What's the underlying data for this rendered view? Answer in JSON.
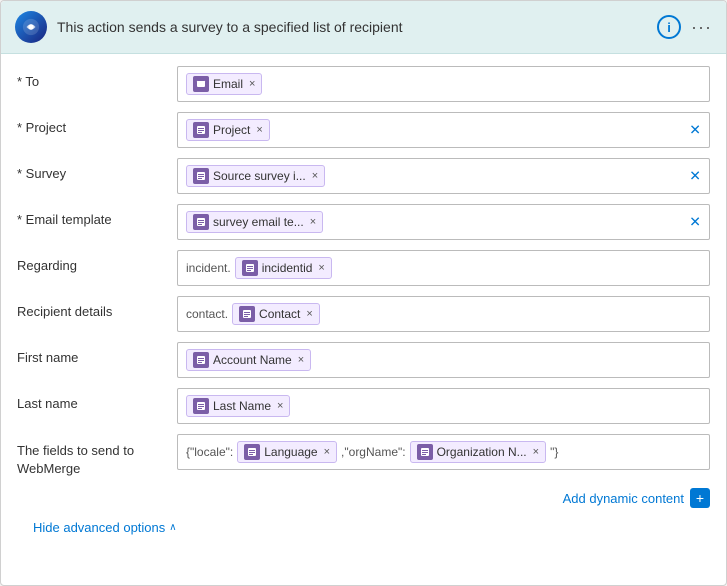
{
  "header": {
    "title": "This action sends a survey to a specified list of recipient",
    "info_label": "i",
    "dots_label": "···"
  },
  "fields": {
    "to": {
      "label": "* To",
      "required": true,
      "chips": [
        {
          "text": "Email",
          "id": "to-email"
        }
      ]
    },
    "project": {
      "label": "* Project",
      "required": true,
      "chips": [
        {
          "text": "Project",
          "id": "project-chip"
        }
      ],
      "has_x": true
    },
    "survey": {
      "label": "* Survey",
      "required": true,
      "chips": [
        {
          "text": "Source survey i...",
          "id": "survey-chip"
        }
      ],
      "has_x": true
    },
    "email_template": {
      "label": "* Email template",
      "required": true,
      "chips": [
        {
          "text": "survey email te...",
          "id": "email-template-chip"
        }
      ],
      "has_x": true
    },
    "regarding": {
      "label": "Regarding",
      "prefix": "incident.",
      "chips": [
        {
          "text": "incidentid",
          "id": "regarding-chip"
        }
      ]
    },
    "recipient_details": {
      "label": "Recipient details",
      "prefix": "contact.",
      "chips": [
        {
          "text": "Contact",
          "id": "recipient-chip"
        }
      ]
    },
    "first_name": {
      "label": "First name",
      "chips": [
        {
          "text": "Account Name",
          "id": "first-name-chip"
        }
      ]
    },
    "last_name": {
      "label": "Last name",
      "chips": [
        {
          "text": "Last Name",
          "id": "last-name-chip"
        }
      ]
    },
    "webmerge": {
      "label": "The fields to send to WebMerge",
      "prefix1": "{\"locale\":",
      "chip1": "Language",
      "between": " ,\"orgName\":",
      "chip2": "Organization N...",
      "suffix": " \"}"
    }
  },
  "add_dynamic": {
    "text": "Add dynamic content",
    "btn": "+"
  },
  "hide_advanced": {
    "text": "Hide advanced options",
    "caret": "∧"
  }
}
